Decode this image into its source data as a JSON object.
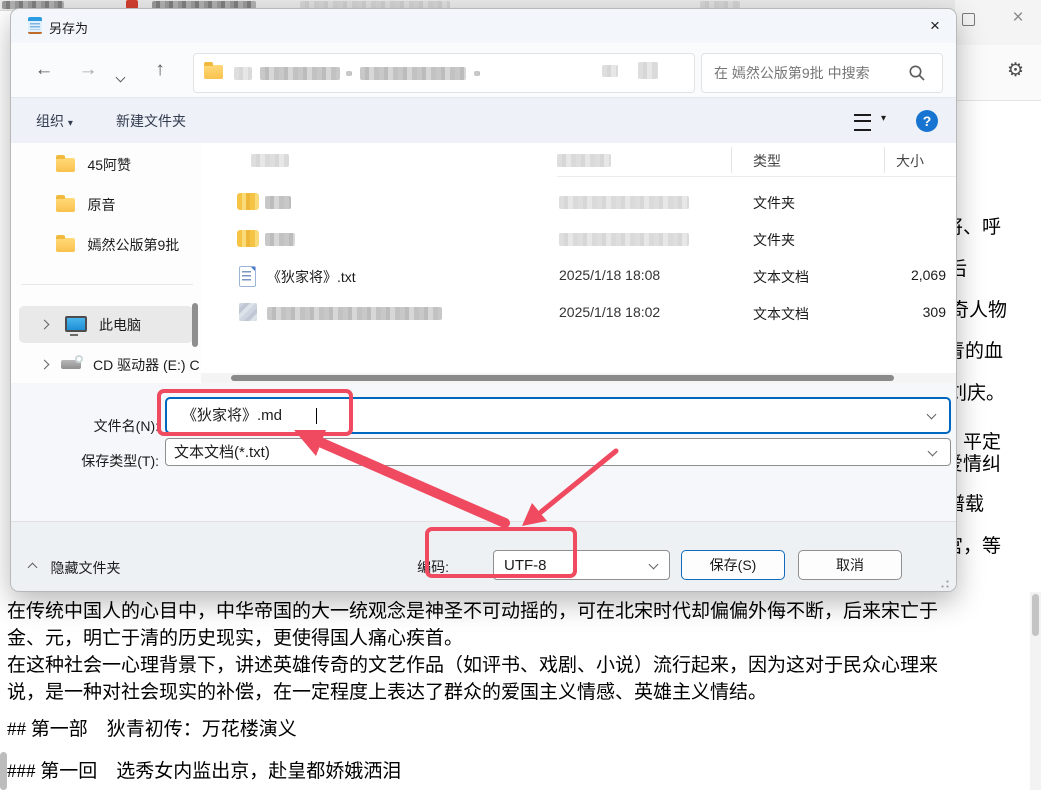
{
  "background_window": {
    "controls": {
      "close_glyph": "×",
      "settings_glyph": "⚙"
    },
    "editor_lines": [
      "在传统中国人的心目中，中华帝国的大一统观念是神圣不可动摇的，可在北宋时代却偏偏外侮不断，后来宋亡于",
      "金、元，明亡于清的历史现实，更使得国人痛心疾首。",
      "在这种社会一心理背景下，讲述英雄传奇的文艺作品（如评书、戏剧、小说）流行起来，因为这对于民众心理来",
      "说，是一种对社会现实的补偿，在一定程度上表达了群众的爱国主义情感、英雄主义情结。"
    ],
    "md_heading1": "## 第一部　狄青初传：万花楼演义",
    "md_heading2": "### 第一回　选秀女内监出京，赴皇都娇娥洒泪",
    "right_fragments": [
      "将、呼",
      "后",
      "奇人物",
      "青的血",
      "刘庆。",
      "，平定",
      "爱情纠",
      "谱载",
      "宫，等"
    ]
  },
  "icons": {
    "back": "←",
    "forward": "→",
    "up": "↑",
    "caret": "▾",
    "close": "×",
    "help": "?",
    "settings": "⚙"
  },
  "dialog": {
    "title": "另存为",
    "search_placeholder": "在 嫣然公版第9批 中搜索",
    "toolbar": {
      "organize": "组织",
      "new_folder": "新建文件夹"
    },
    "sidebar": {
      "items": [
        "45阿赞",
        "原音",
        "嫣然公版第9批"
      ],
      "this_pc": "此电脑",
      "cd_drive": "CD 驱动器 (E:) C"
    },
    "list": {
      "col_type": "类型",
      "col_size": "大小",
      "rows": [
        {
          "name": "",
          "date": "",
          "type": "文件夹",
          "size": ""
        },
        {
          "name": "",
          "date": "",
          "type": "文件夹",
          "size": ""
        },
        {
          "name": "《狄家将》.txt",
          "date": "2025/1/18 18:08",
          "type": "文本文档",
          "size": "2,069"
        },
        {
          "name": "",
          "date": "2025/1/18 18:02",
          "type": "文本文档",
          "size": "309"
        }
      ]
    },
    "filename_label": "文件名(N):",
    "filename_value": "《狄家将》.md",
    "savetype_label": "保存类型(T):",
    "savetype_value": "文本文档(*.txt)",
    "encoding_label": "编码:",
    "encoding_value": "UTF-8",
    "save_button": "保存(S)",
    "cancel_button": "取消",
    "hide_folders": "隐藏文件夹"
  },
  "colors": {
    "accent": "#0067c0",
    "annotation": "#ef4a60",
    "help_badge": "#1775d1"
  }
}
